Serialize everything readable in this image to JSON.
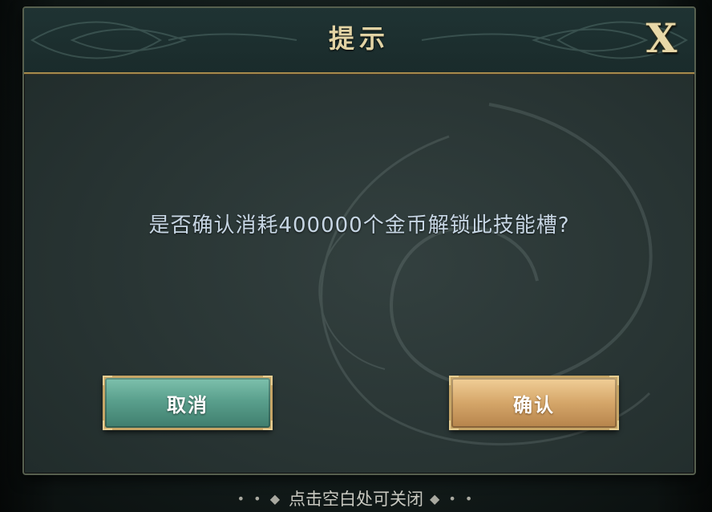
{
  "dialog": {
    "title": "提示",
    "close_label": "X",
    "message": "是否确认消耗400000个金币解锁此技能槽?",
    "cancel_label": "取消",
    "confirm_label": "确认"
  },
  "footer": {
    "hint": "点击空白处可关闭",
    "deco_left": "• • ◆",
    "deco_right": "◆ • •"
  },
  "colors": {
    "accent_gold": "#c6a566",
    "title_text": "#e2d3a4",
    "message_text": "#c7d6e4",
    "cancel_bg": "#5aa08d",
    "confirm_bg": "#d5a669"
  }
}
